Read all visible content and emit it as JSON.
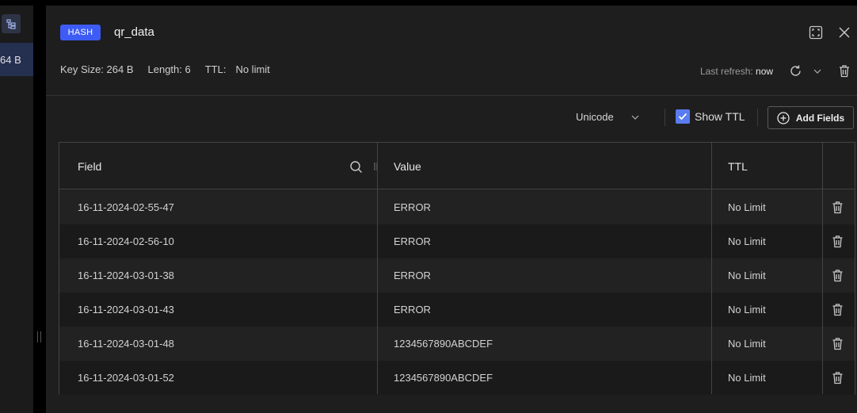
{
  "sidebar": {
    "item_label": "64 B"
  },
  "key": {
    "type_badge": "HASH",
    "name": "qr_data",
    "meta": {
      "key_size": "Key Size: 264 B",
      "length": "Length: 6",
      "ttl_label": "TTL:",
      "ttl_value": "No limit"
    },
    "last_refresh_label": "Last refresh:",
    "last_refresh_value": "now"
  },
  "toolbar": {
    "encoding": "Unicode",
    "show_ttl_label": "Show TTL",
    "show_ttl_checked": true,
    "add_fields_label": "Add Fields"
  },
  "table": {
    "columns": [
      "Field",
      "Value",
      "TTL"
    ],
    "rows": [
      {
        "field": "16-11-2024-02-55-47",
        "value": "ERROR",
        "ttl": "No Limit"
      },
      {
        "field": "16-11-2024-02-56-10",
        "value": "ERROR",
        "ttl": "No Limit"
      },
      {
        "field": "16-11-2024-03-01-38",
        "value": "ERROR",
        "ttl": "No Limit"
      },
      {
        "field": "16-11-2024-03-01-43",
        "value": "ERROR",
        "ttl": "No Limit"
      },
      {
        "field": "16-11-2024-03-01-48",
        "value": "1234567890ABCDEF",
        "ttl": "No Limit"
      },
      {
        "field": "16-11-2024-03-01-52",
        "value": "1234567890ABCDEF",
        "ttl": "No Limit"
      }
    ]
  },
  "colors": {
    "accent": "#3d5cf5",
    "checkbox": "#5a7cf0"
  }
}
